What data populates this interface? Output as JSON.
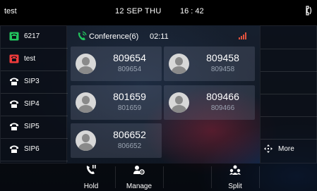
{
  "status_bar": {
    "account": "test",
    "date": "12 SEP THU",
    "time": "16 : 42"
  },
  "line_keys": [
    {
      "label": "6217",
      "icon": "green-phone-icon",
      "color": "#22c55e"
    },
    {
      "label": "test",
      "icon": "red-phone-icon",
      "color": "#ef3b3b"
    },
    {
      "label": "SIP3",
      "icon": "white-phone-icon",
      "color": "#ffffff"
    },
    {
      "label": "SIP4",
      "icon": "white-phone-icon",
      "color": "#ffffff"
    },
    {
      "label": "SIP5",
      "icon": "white-phone-icon",
      "color": "#ffffff"
    },
    {
      "label": "SIP6",
      "icon": "white-phone-icon",
      "color": "#ffffff"
    }
  ],
  "conference": {
    "title": "Conference(6)",
    "timer": "02:11",
    "icon_color": "#22c55e",
    "signal_color": "#e0523e"
  },
  "parties": [
    {
      "number": "809654",
      "sub": "809654"
    },
    {
      "number": "809458",
      "sub": "809458"
    },
    {
      "number": "801659",
      "sub": "801659"
    },
    {
      "number": "809466",
      "sub": "809466"
    },
    {
      "number": "806652",
      "sub": "806652"
    }
  ],
  "right_softkeys": {
    "more_label": "More"
  },
  "softkeys": [
    {
      "label": "Hold",
      "icon": "hold-phone-icon"
    },
    {
      "label": "Manage",
      "icon": "manage-users-icon"
    },
    {
      "label": "",
      "icon": ""
    },
    {
      "label": "Split",
      "icon": "split-users-icon"
    },
    {
      "label": "",
      "icon": ""
    }
  ]
}
